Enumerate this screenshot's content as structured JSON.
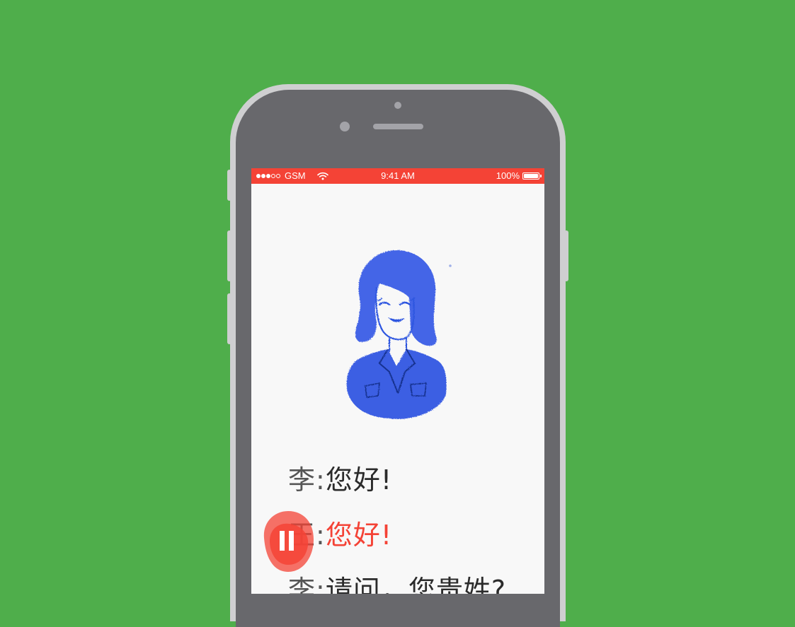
{
  "colors": {
    "background": "#4fae4b",
    "accent": "#f44336",
    "illustration": "#2f57e0"
  },
  "status_bar": {
    "carrier": "GSM",
    "signal_full": 3,
    "signal_total": 5,
    "time": "9:41 AM",
    "battery": "100%",
    "battery_level": 1.0,
    "wifi_icon": "wifi-icon",
    "battery_icon": "battery-icon"
  },
  "illustration": {
    "icon": "woman-portrait-drawing"
  },
  "dialogue": [
    {
      "speaker": "李:",
      "text": "您好!",
      "active": false
    },
    {
      "speaker": "王:",
      "text": "您好!",
      "active": true
    },
    {
      "speaker": "李:",
      "text": "请问，您贵姓?",
      "active": false
    }
  ],
  "player": {
    "state": "playing",
    "icon": "pause-icon"
  }
}
